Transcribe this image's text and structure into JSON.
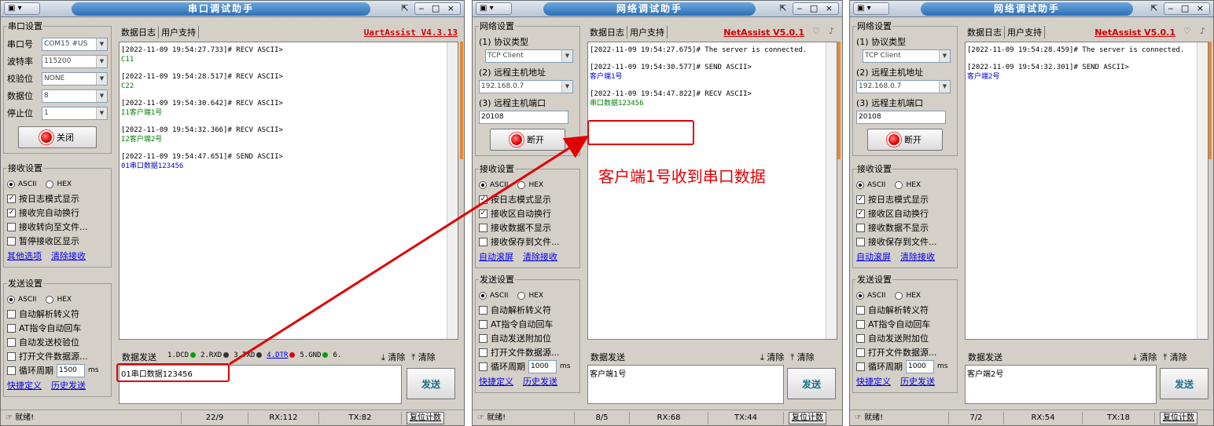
{
  "serial": {
    "title": "串口调试助手",
    "brand": "UartAssist V4.3.13",
    "tabs": [
      "数据日志",
      "用户支持"
    ],
    "port_settings": {
      "legend": "串口设置",
      "fields": [
        {
          "label": "串口号",
          "value": "COM15 #US"
        },
        {
          "label": "波特率",
          "value": "115200"
        },
        {
          "label": "校验位",
          "value": "NONE"
        },
        {
          "label": "数据位",
          "value": "8"
        },
        {
          "label": "停止位",
          "value": "1"
        }
      ],
      "button": "关闭"
    },
    "recv_settings": {
      "legend": "接收设置",
      "ascii": "ASCII",
      "hex": "HEX",
      "options": [
        {
          "label": "按日志模式显示",
          "checked": true
        },
        {
          "label": "接收完自动换行",
          "checked": true
        },
        {
          "label": "接收转向至文件...",
          "checked": false
        },
        {
          "label": "暂停接收区显示",
          "checked": false
        }
      ],
      "links": [
        "其他选项",
        "清除接收"
      ]
    },
    "send_settings": {
      "legend": "发送设置",
      "ascii": "ASCII",
      "hex": "HEX",
      "options": [
        {
          "label": "自动解析转义符",
          "checked": false
        },
        {
          "label": "AT指令自动回车",
          "checked": false
        },
        {
          "label": "自动发送校验位",
          "checked": false
        },
        {
          "label": "打开文件数据源...",
          "checked": false
        }
      ],
      "cycle_label": "循环周期",
      "cycle_value": "1500",
      "cycle_unit": "ms",
      "links": [
        "快捷定义",
        "历史发送"
      ]
    },
    "log": [
      {
        "header": "[2022-11-09 19:54:27.733]# RECV ASCII>",
        "body": "C11",
        "kind": "recv"
      },
      {
        "header": "[2022-11-09 19:54:28.517]# RECV ASCII>",
        "body": "C22",
        "kind": "recv"
      },
      {
        "header": "[2022-11-09 19:54:30.642]# RECV ASCII>",
        "body": "I1客户端1号",
        "kind": "recv"
      },
      {
        "header": "[2022-11-09 19:54:32.366]# RECV ASCII>",
        "body": "I2客户端2号",
        "kind": "recv"
      },
      {
        "header": "[2022-11-09 19:54:47.651]# SEND ASCII>",
        "body": "01串口数据123456",
        "kind": "send"
      }
    ],
    "send_label": "数据发送",
    "signals": [
      {
        "label": "1.DCD",
        "color": "#00a000"
      },
      {
        "label": "2.RXD",
        "color": "#333333"
      },
      {
        "label": "3.TXD",
        "color": "#333333"
      },
      {
        "label": "4.DTR",
        "color": "#e00000"
      },
      {
        "label": "5.GND",
        "color": "#00a000"
      },
      {
        "label": "6.",
        "color": ""
      }
    ],
    "clear1": "清除",
    "clear2": "清除",
    "send_text": "01串口数据123456",
    "send_button": "发送",
    "status": {
      "ready": "就绪!",
      "count": "22/9",
      "rx": "RX:112",
      "tx": "TX:82",
      "reset": "复位计数"
    }
  },
  "net1": {
    "title": "网络调试助手",
    "brand": "NetAssist V5.0.1",
    "tabs": [
      "数据日志",
      "用户支持"
    ],
    "net_settings": {
      "legend": "网络设置",
      "proto_label": "(1) 协议类型",
      "proto_value": "TCP Client",
      "host_label": "(2) 远程主机地址",
      "host_value": "192.168.0.7",
      "port_label": "(3) 远程主机端口",
      "port_value": "20108",
      "button": "断开"
    },
    "recv_settings": {
      "legend": "接收设置",
      "ascii": "ASCII",
      "hex": "HEX",
      "options": [
        {
          "label": "按日志模式显示",
          "checked": true
        },
        {
          "label": "接收区自动换行",
          "checked": true
        },
        {
          "label": "接收数据不显示",
          "checked": false
        },
        {
          "label": "接收保存到文件...",
          "checked": false
        }
      ],
      "links": [
        "自动滚屏",
        "清除接收"
      ]
    },
    "send_settings": {
      "legend": "发送设置",
      "ascii": "ASCII",
      "hex": "HEX",
      "options": [
        {
          "label": "自动解析转义符",
          "checked": false
        },
        {
          "label": "AT指令自动回车",
          "checked": false
        },
        {
          "label": "自动发送附加位",
          "checked": false
        },
        {
          "label": "打开文件数据源...",
          "checked": false
        }
      ],
      "cycle_label": "循环周期",
      "cycle_value": "1000",
      "cycle_unit": "ms",
      "links": [
        "快捷定义",
        "历史发送"
      ]
    },
    "log": [
      {
        "header": "[2022-11-09 19:54:27.675]# The server is connected.",
        "body": "",
        "kind": "recv"
      },
      {
        "header": "[2022-11-09 19:54:30.577]# SEND ASCII>",
        "body": "客户端1号",
        "kind": "send"
      },
      {
        "header": "[2022-11-09 19:54:47.822]# RECV ASCII>",
        "body": "串口数据123456",
        "kind": "recv"
      }
    ],
    "send_label": "数据发送",
    "clear1": "清除",
    "clear2": "清除",
    "send_text": "客户端1号",
    "send_button": "发送",
    "status": {
      "ready": "就绪!",
      "count": "8/5",
      "rx": "RX:68",
      "tx": "TX:44",
      "reset": "复位计数"
    },
    "annotation": "客户端1号收到串口数据"
  },
  "net2": {
    "title": "网络调试助手",
    "brand": "NetAssist V5.0.1",
    "tabs": [
      "数据日志",
      "用户支持"
    ],
    "net_settings": {
      "legend": "网络设置",
      "proto_label": "(1) 协议类型",
      "proto_value": "TCP Client",
      "host_label": "(2) 远程主机地址",
      "host_value": "192.168.0.7",
      "port_label": "(3) 远程主机端口",
      "port_value": "20108",
      "button": "断开"
    },
    "recv_settings": {
      "legend": "接收设置",
      "ascii": "ASCII",
      "hex": "HEX",
      "options": [
        {
          "label": "按日志模式显示",
          "checked": true
        },
        {
          "label": "接收区自动换行",
          "checked": true
        },
        {
          "label": "接收数据不显示",
          "checked": false
        },
        {
          "label": "接收保存到文件...",
          "checked": false
        }
      ],
      "links": [
        "自动滚屏",
        "清除接收"
      ]
    },
    "send_settings": {
      "legend": "发送设置",
      "ascii": "ASCII",
      "hex": "HEX",
      "options": [
        {
          "label": "自动解析转义符",
          "checked": false
        },
        {
          "label": "AT指令自动回车",
          "checked": false
        },
        {
          "label": "自动发送附加位",
          "checked": false
        },
        {
          "label": "打开文件数据源...",
          "checked": false
        }
      ],
      "cycle_label": "循环周期",
      "cycle_value": "1000",
      "cycle_unit": "ms",
      "links": [
        "快捷定义",
        "历史发送"
      ]
    },
    "log": [
      {
        "header": "[2022-11-09 19:54:28.459]# The server is connected.",
        "body": "",
        "kind": "recv"
      },
      {
        "header": "[2022-11-09 19:54:32.301]# SEND ASCII>",
        "body": "客户端2号",
        "kind": "send"
      }
    ],
    "send_label": "数据发送",
    "clear1": "清除",
    "clear2": "清除",
    "send_text": "客户端2号",
    "send_button": "发送",
    "status": {
      "ready": "就绪!",
      "count": "7/2",
      "rx": "RX:54",
      "tx": "TX:18",
      "reset": "复位计数"
    }
  }
}
